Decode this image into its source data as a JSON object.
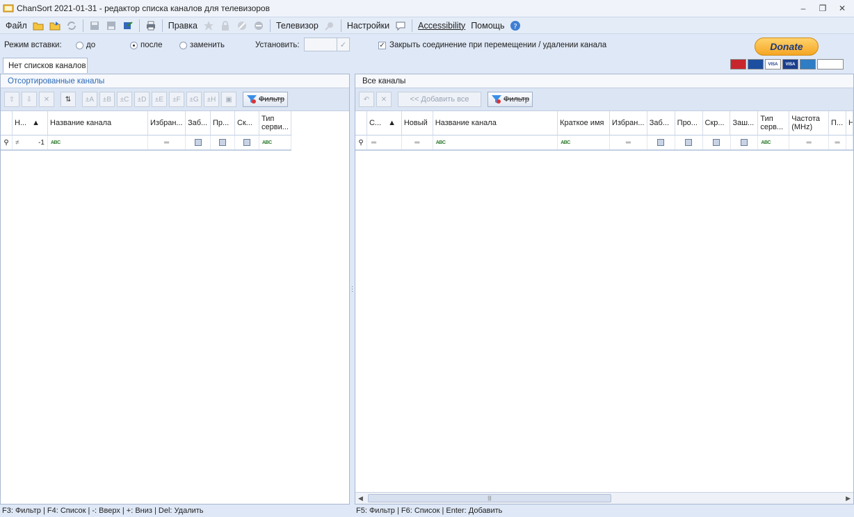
{
  "window": {
    "title": "ChanSort 2021-01-31 - редактор списка каналов для телевизоров",
    "controls": [
      "minimize",
      "restore",
      "close"
    ]
  },
  "menu": {
    "file": "Файл",
    "edit": "Правка",
    "tv": "Телевизор",
    "settings": "Настройки",
    "accessibility": "Accessibility",
    "help": "Помощь"
  },
  "options": {
    "insert_mode_label": "Режим вставки:",
    "radio_before": "до",
    "radio_after": "после",
    "radio_replace": "заменить",
    "selected_radio": "после",
    "set_label": "Установить:",
    "close_gap_label": "Закрыть соединение при перемещении / удалении канала",
    "close_gap_checked": true
  },
  "donate": {
    "label": "Donate",
    "cards": [
      "MasterCard",
      "Maestro",
      "VISA",
      "VISA",
      "AmEx",
      "DIRECT Debit"
    ]
  },
  "tab": {
    "label": "Нет списков каналов"
  },
  "left_panel": {
    "title": "Отсортированные каналы",
    "toolbar_letters": [
      "±A",
      "±B",
      "±C",
      "±D",
      "±E",
      "±F",
      "±G",
      "±H"
    ],
    "filter_label": "Фильтр",
    "columns": [
      "Н...",
      "Название канала",
      "Избран...",
      "Заб...",
      "Пр...",
      "Ск...",
      "Тип серви..."
    ],
    "filter_row_number": "-1"
  },
  "right_panel": {
    "title": "Все каналы",
    "add_all_label": "<< Добавить все",
    "filter_label": "Фильтр",
    "columns": [
      "С...",
      "Новый",
      "Название канала",
      "Краткое имя",
      "Избран...",
      "Заб...",
      "Про...",
      "Скр...",
      "Заш...",
      "Тип серв...",
      "Частота (MHz)",
      "П...",
      "Н"
    ]
  },
  "statusbar": {
    "left": "F3: Фильтр | F4: Список | -: Вверх | +: Вниз | Del: Удалить",
    "right": "F5: Фильтр | F6: Список | Enter: Добавить"
  },
  "icons": {
    "toolbar": [
      "open-folder-icon",
      "open-recent-icon",
      "reload-icon",
      "save-icon",
      "save-as-icon",
      "export-icon",
      "print-icon",
      "star-icon",
      "lock-icon",
      "skip-icon",
      "hide-icon",
      "tv-settings-icon",
      "chat-icon",
      "help-icon"
    ]
  }
}
